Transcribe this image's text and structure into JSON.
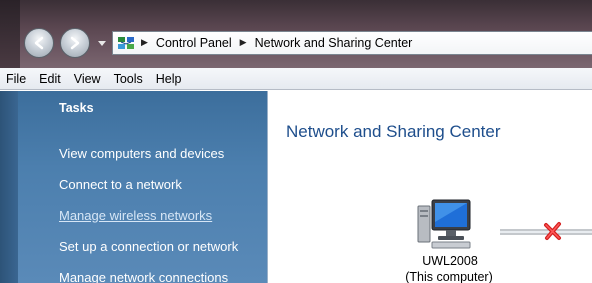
{
  "address_bar": {
    "breadcrumbs": [
      "Control Panel",
      "Network and Sharing Center"
    ]
  },
  "menu": {
    "items": [
      "File",
      "Edit",
      "View",
      "Tools",
      "Help"
    ]
  },
  "tasks": {
    "heading": "Tasks",
    "links": [
      "View computers and devices",
      "Connect to a network",
      "Manage wireless networks",
      "Set up a connection or network",
      "Manage network connections"
    ],
    "active_index": 2
  },
  "main": {
    "title": "Network and Sharing Center",
    "computer": {
      "name": "UWL2008",
      "subtitle": "(This computer)"
    },
    "connection_status_icon": "red-x-icon"
  },
  "colors": {
    "task_pane": "#4c7fae",
    "title_text": "#1e4e8c",
    "disconnect": "#d42020"
  }
}
